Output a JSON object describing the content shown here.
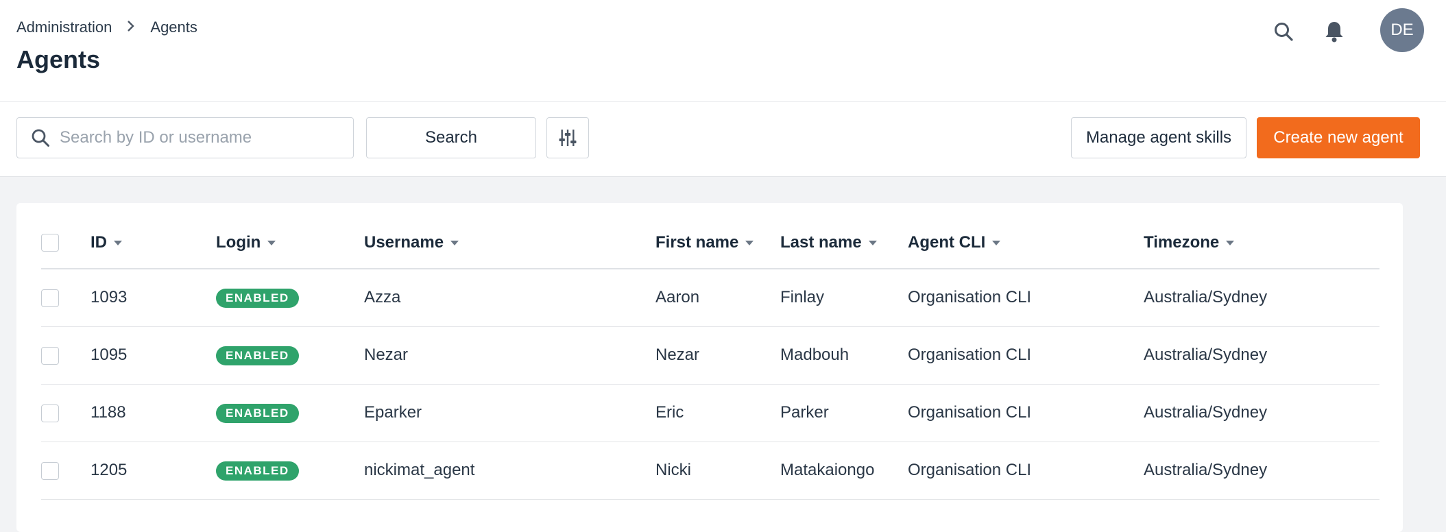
{
  "breadcrumb": {
    "parent": "Administration",
    "current": "Agents"
  },
  "page_title": "Agents",
  "header": {
    "avatar_initials": "DE",
    "icons": [
      "search-icon",
      "bell-icon"
    ]
  },
  "toolbar": {
    "search_placeholder": "Search by ID or username",
    "search_value": "",
    "search_button": "Search",
    "filter_icon": "sliders-icon",
    "manage_skills": "Manage agent skills",
    "create_agent": "Create new agent"
  },
  "colors": {
    "primary": "#f26b1d",
    "enabled_badge": "#2fa36b",
    "avatar": "#6b7a8f"
  },
  "table": {
    "headers": {
      "id": "ID",
      "login": "Login",
      "username": "Username",
      "first_name": "First name",
      "last_name": "Last name",
      "agent_cli": "Agent CLI",
      "timezone": "Timezone"
    },
    "rows": [
      {
        "id": "1093",
        "login": "ENABLED",
        "username": "Azza",
        "first_name": "Aaron",
        "last_name": "Finlay",
        "agent_cli": "Organisation CLI",
        "timezone": "Australia/Sydney"
      },
      {
        "id": "1095",
        "login": "ENABLED",
        "username": "Nezar",
        "first_name": "Nezar",
        "last_name": "Madbouh",
        "agent_cli": "Organisation CLI",
        "timezone": "Australia/Sydney"
      },
      {
        "id": "1188",
        "login": "ENABLED",
        "username": "Eparker",
        "first_name": "Eric",
        "last_name": "Parker",
        "agent_cli": "Organisation CLI",
        "timezone": "Australia/Sydney"
      },
      {
        "id": "1205",
        "login": "ENABLED",
        "username": "nickimat_agent",
        "first_name": "Nicki",
        "last_name": "Matakaiongo",
        "agent_cli": "Organisation CLI",
        "timezone": "Australia/Sydney"
      }
    ]
  }
}
